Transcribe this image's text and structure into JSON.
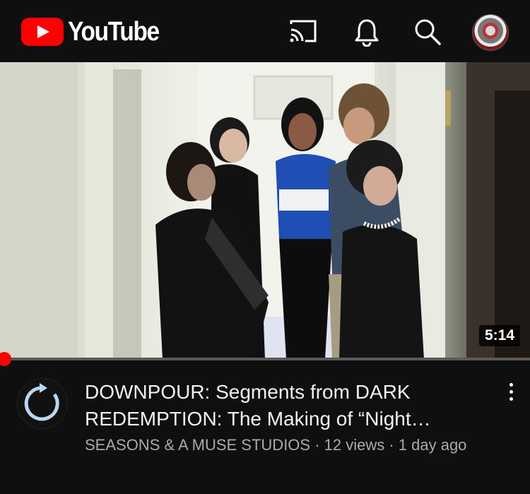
{
  "header": {
    "logo_text": "YouTube",
    "icons": [
      "cast-icon",
      "notifications-bell-icon",
      "search-icon",
      "account-avatar"
    ]
  },
  "video": {
    "duration": "5:14",
    "progress_fraction": 0.01,
    "title": "DOWNPOUR: Segments from DARK REDEMPTION: The Making of “Night…",
    "meta": "SEASONS & A MUSE STUDIOS · 12 views · 1 day ago",
    "more_icon": "more-vert-icon"
  },
  "colors": {
    "background": "#0f0f0f",
    "brand_red": "#ff0000",
    "secondary_text": "#aaaaaa"
  }
}
